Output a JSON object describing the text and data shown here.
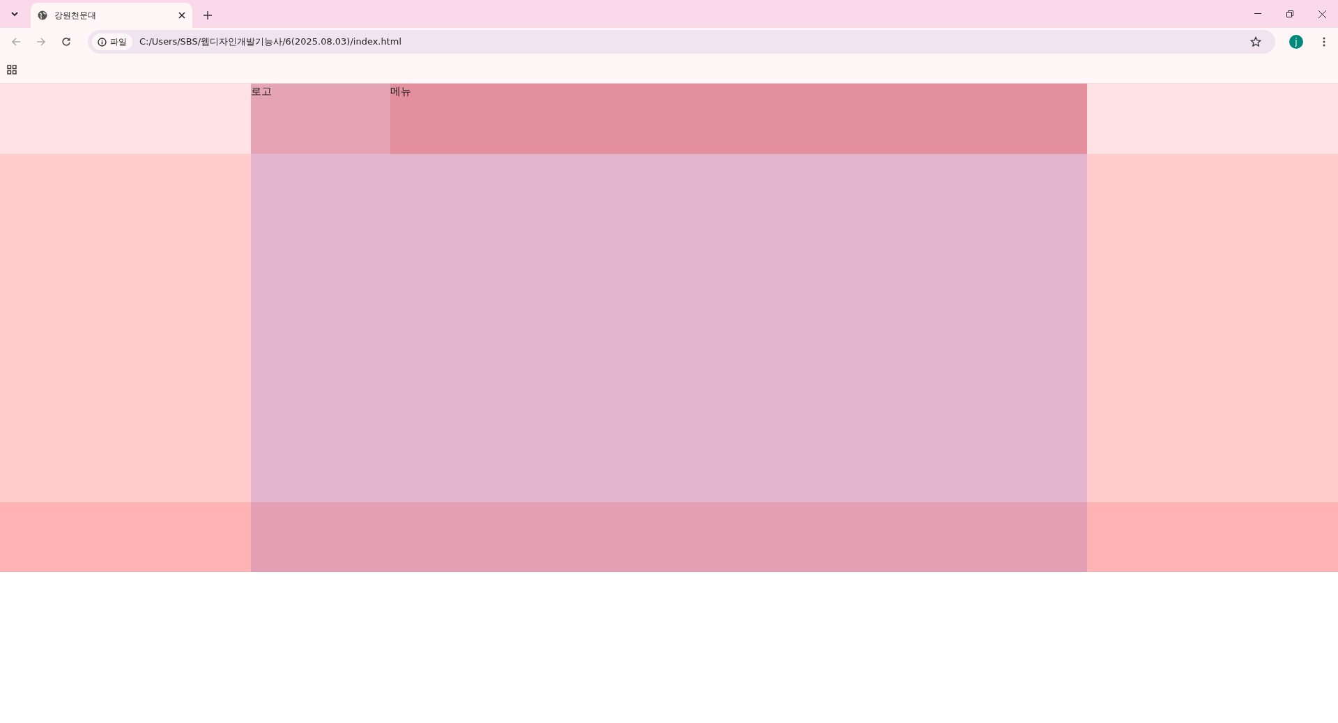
{
  "browser": {
    "tab": {
      "title": "강원천문대",
      "selected": true
    },
    "address": {
      "scheme_label": "파일",
      "url": "C:/Users/SBS/웹디자인개발기능사/6(2025.08.03)/index.html"
    },
    "profile_initial": "j"
  },
  "page": {
    "header": {
      "logo": "로고",
      "menu": "메뉴"
    }
  }
}
